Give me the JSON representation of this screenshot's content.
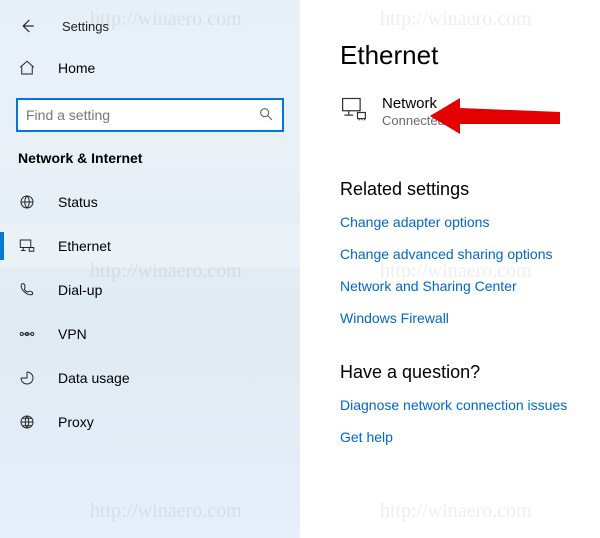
{
  "app_title": "Settings",
  "search": {
    "placeholder": "Find a setting"
  },
  "sidebar": {
    "home_label": "Home",
    "section_header": "Network & Internet",
    "items": [
      {
        "label": "Status"
      },
      {
        "label": "Ethernet"
      },
      {
        "label": "Dial-up"
      },
      {
        "label": "VPN"
      },
      {
        "label": "Data usage"
      },
      {
        "label": "Proxy"
      }
    ]
  },
  "content": {
    "page_title": "Ethernet",
    "network": {
      "name": "Network",
      "status": "Connected"
    },
    "related": {
      "title": "Related settings",
      "links": [
        "Change adapter options",
        "Change advanced sharing options",
        "Network and Sharing Center",
        "Windows Firewall"
      ]
    },
    "question": {
      "title": "Have a question?",
      "links": [
        "Diagnose network connection issues",
        "Get help"
      ]
    }
  },
  "watermark": "http://winaero.com"
}
